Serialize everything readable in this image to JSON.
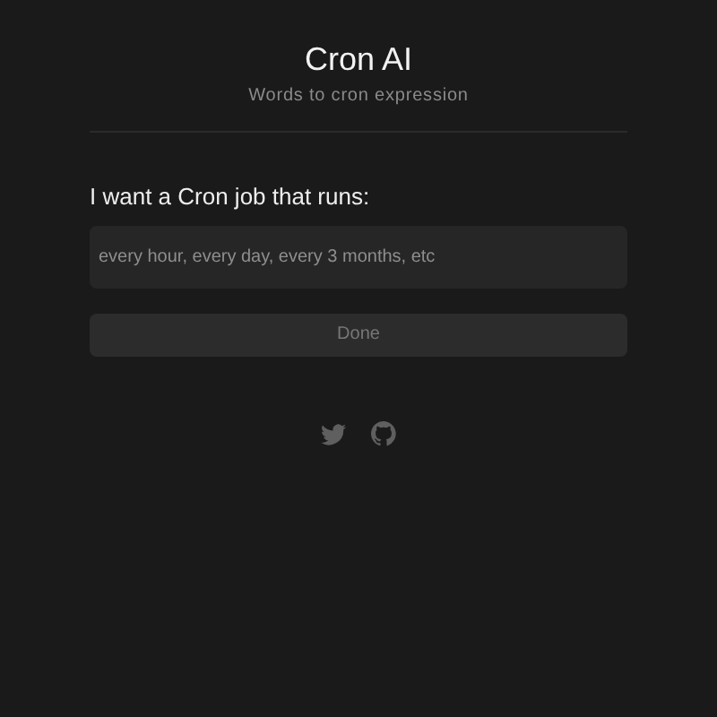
{
  "header": {
    "title": "Cron AI",
    "subtitle": "Words to cron expression"
  },
  "form": {
    "label": "I want a Cron job that runs:",
    "placeholder": "every hour, every day, every 3 months, etc"
  },
  "button": {
    "label": "Done",
    "disabled": true
  },
  "social_links": [
    {
      "kind": "twitter"
    },
    {
      "kind": "github"
    }
  ]
}
